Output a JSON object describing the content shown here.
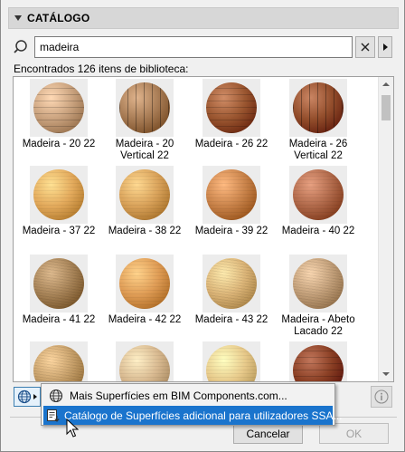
{
  "panel": {
    "title": "CATÁLOGO"
  },
  "search": {
    "value": "madeira",
    "placeholder": ""
  },
  "results": {
    "count_text": "Encontrados 126 itens de biblioteca:"
  },
  "materials": [
    {
      "label": "Madeira - 20 22",
      "color": "#c9a27e",
      "style": "stripes-light"
    },
    {
      "label": "Madeira - 20 Vertical 22",
      "color": "#a87c55",
      "style": "vertical-light"
    },
    {
      "label": "Madeira - 26 22",
      "color": "#9a5630",
      "style": "stripes-dark"
    },
    {
      "label": "Madeira - 26 Vertical 22",
      "color": "#934e2c",
      "style": "vertical-dark"
    },
    {
      "label": "Madeira - 37 22",
      "color": "#e3aa5c",
      "style": "smooth"
    },
    {
      "label": "Madeira - 38 22",
      "color": "#d9a25a",
      "style": "smooth"
    },
    {
      "label": "Madeira - 39 22",
      "color": "#c9834a",
      "style": "smooth"
    },
    {
      "label": "Madeira - 40 22",
      "color": "#b0694a",
      "style": "smooth"
    },
    {
      "label": "Madeira - 41 22",
      "color": "#a88458",
      "style": "grain"
    },
    {
      "label": "Madeira - 42 22",
      "color": "#df9c55",
      "style": "smooth"
    },
    {
      "label": "Madeira - 43 22",
      "color": "#dcb578",
      "style": "grain"
    },
    {
      "label": "Madeira - Abeto Lacado 22",
      "color": "#c3a07a",
      "style": "grain"
    },
    {
      "label": "",
      "color": "#c7a06a",
      "style": "grain"
    },
    {
      "label": "",
      "color": "#d8b990",
      "style": "smooth"
    },
    {
      "label": "",
      "color": "#e7c98a",
      "style": "smooth"
    },
    {
      "label": "",
      "color": "#8a3f24",
      "style": "stripes-dark"
    }
  ],
  "menu": {
    "item1": "Mais Superfícies em BIM Components.com...",
    "item2": "Catálogo de Superfícies adicional para utilizadores SSA..."
  },
  "buttons": {
    "cancel": "Cancelar",
    "ok": "OK"
  },
  "icons": {
    "search": "search-icon",
    "clear": "close-icon",
    "next": "chevron-right-icon",
    "globe": "globe-icon",
    "info": "info-icon"
  },
  "colors": {
    "highlight": "#1a74cd",
    "header_bg": "#d7d7d7"
  }
}
